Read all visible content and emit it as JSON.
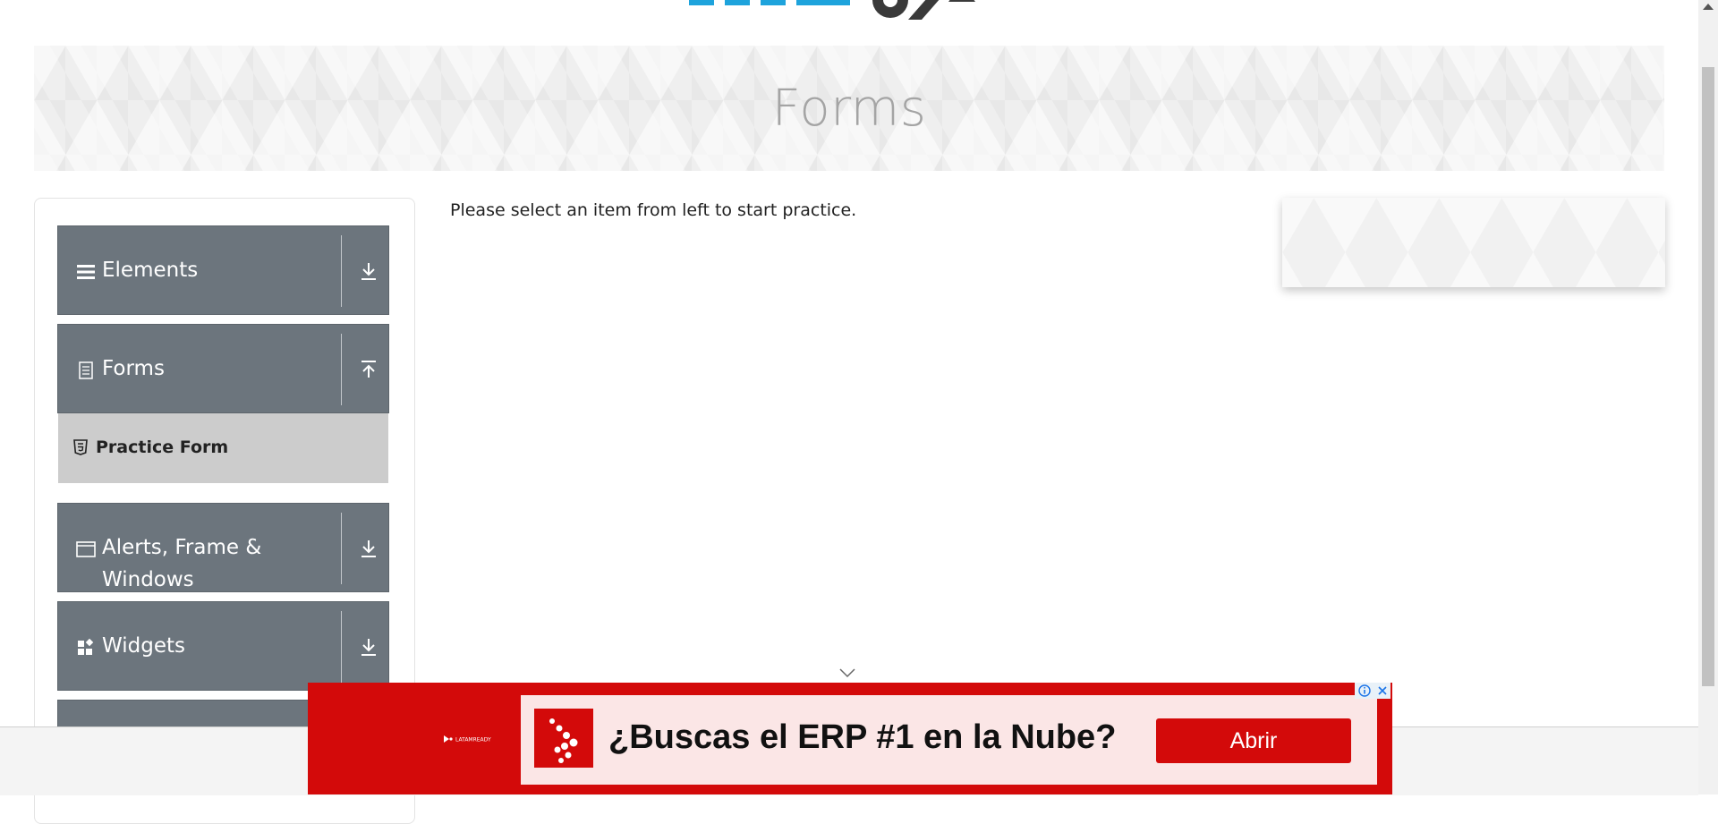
{
  "page": {
    "title": "Forms",
    "instruction": "Please select an item from left to start practice."
  },
  "sidebar": {
    "groups": [
      {
        "label": "Elements",
        "icon": "hamburger-icon",
        "state": "collapsed"
      },
      {
        "label": "Forms",
        "icon": "document-icon",
        "state": "expanded"
      },
      {
        "label": "Alerts, Frame & Windows",
        "icon": "window-icon",
        "state": "collapsed"
      },
      {
        "label": "Widgets",
        "icon": "widgets-icon",
        "state": "collapsed"
      }
    ],
    "forms_items": [
      {
        "label": "Practice Form",
        "icon": "html5-icon"
      }
    ]
  },
  "ad": {
    "headline": "¿Buscas el ERP #1 en la Nube?",
    "cta": "Abrir",
    "brand": "LATAMREADY"
  },
  "colors": {
    "sidebar_group_bg": "#6c757d",
    "sub_item_bg": "#cccccc",
    "ad_red": "#d30a0a",
    "banner_title": "#a4a4a4"
  }
}
